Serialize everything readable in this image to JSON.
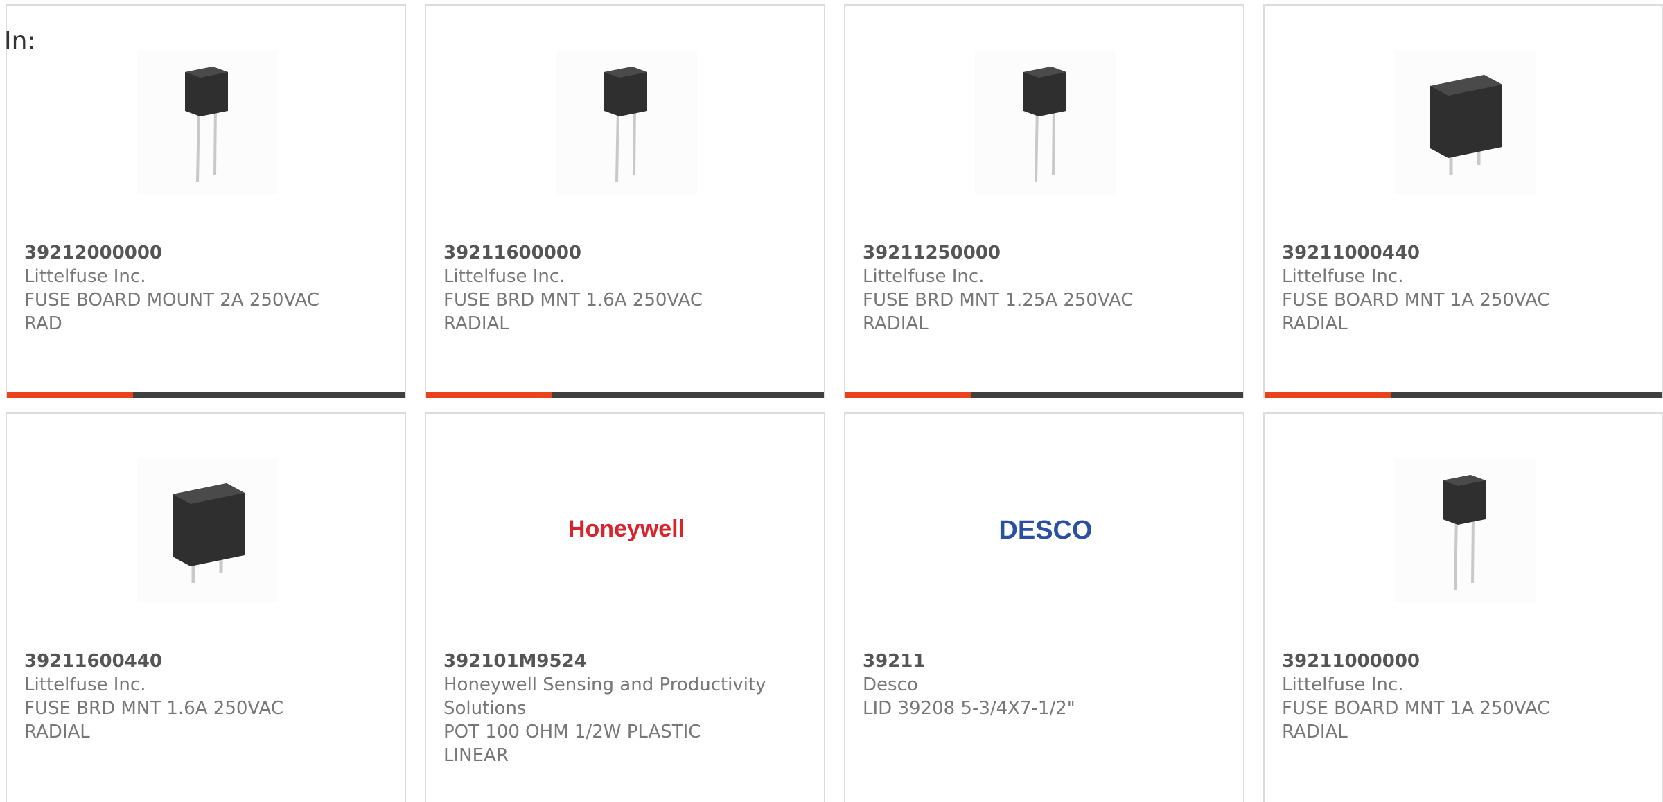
{
  "header": {
    "in_label": "In:"
  },
  "colors": {
    "accent": "#e8431a",
    "bar": "#404040",
    "honeywell": "#d9242b",
    "desco": "#2a4fa3"
  },
  "products": [
    {
      "part_number": "39212000000",
      "manufacturer": "Littelfuse Inc.",
      "description": "FUSE BOARD MOUNT 2A 250VAC RAD",
      "image": "fuse-small-icon"
    },
    {
      "part_number": "39211600000",
      "manufacturer": "Littelfuse Inc.",
      "description": "FUSE BRD MNT 1.6A 250VAC RADIAL",
      "image": "fuse-small-icon"
    },
    {
      "part_number": "39211250000",
      "manufacturer": "Littelfuse Inc.",
      "description": "FUSE BRD MNT 1.25A 250VAC RADIAL",
      "image": "fuse-small-icon"
    },
    {
      "part_number": "39211000440",
      "manufacturer": "Littelfuse Inc.",
      "description": "FUSE BOARD MNT 1A 250VAC RADIAL",
      "image": "fuse-large-icon"
    },
    {
      "part_number": "39211600440",
      "manufacturer": "Littelfuse Inc.",
      "description": "FUSE BRD MNT 1.6A 250VAC RADIAL",
      "image": "fuse-large-icon"
    },
    {
      "part_number": "392101M9524",
      "manufacturer": "Honeywell Sensing and Productivity Solutions",
      "description": "POT 100 OHM 1/2W PLASTIC LINEAR",
      "image": "honeywell-logo",
      "logo_text": "Honeywell"
    },
    {
      "part_number": "39211",
      "manufacturer": "Desco",
      "description": "LID 39208 5-3/4X7-1/2\"",
      "image": "desco-logo",
      "logo_text": "DESCO"
    },
    {
      "part_number": "39211000000",
      "manufacturer": "Littelfuse Inc.",
      "description": "FUSE BOARD MNT 1A 250VAC RADIAL",
      "image": "fuse-small-icon"
    }
  ]
}
